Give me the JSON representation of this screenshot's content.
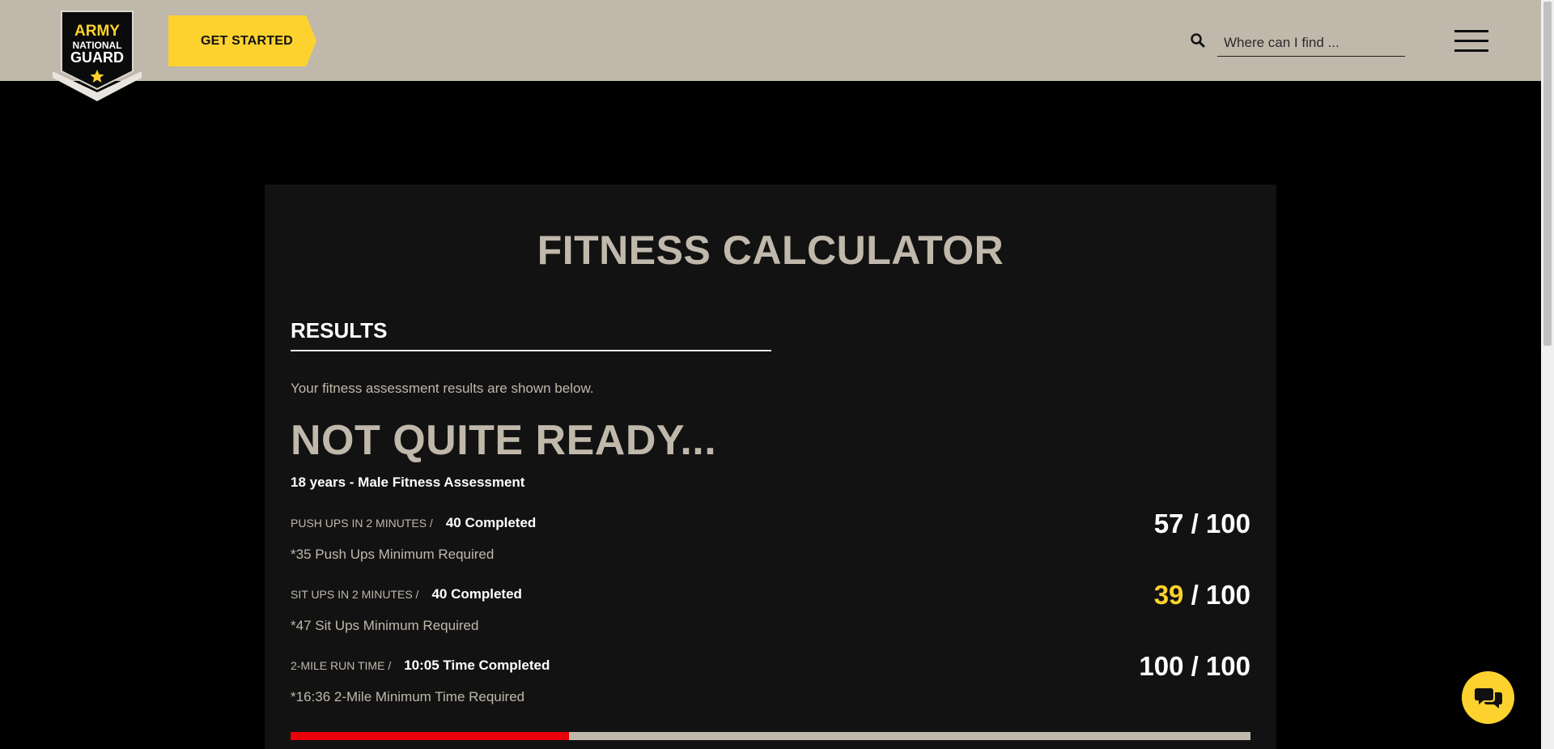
{
  "header": {
    "logo": {
      "line1": "ARMY",
      "line2": "NATIONAL",
      "line3": "GUARD",
      "icon": "star-icon"
    },
    "get_started_label": "GET STARTED",
    "search": {
      "placeholder": "Where can I find ...",
      "icon": "search-icon"
    },
    "menu_icon": "hamburger-menu-icon"
  },
  "calculator": {
    "title": "FITNESS CALCULATOR",
    "results_heading": "RESULTS",
    "intro": "Your fitness assessment results are shown below.",
    "verdict": "NOT QUITE READY...",
    "assessment": "18 years - Male Fitness Assessment",
    "rows": [
      {
        "label": "PUSH UPS IN 2 MINUTES /",
        "completed": "40 Completed",
        "note": "*35 Push Ups Minimum Required",
        "score": "57",
        "max": "/ 100"
      },
      {
        "label": "SIT UPS IN 2 MINUTES /",
        "completed": "40 Completed",
        "note": "*47 Sit Ups Minimum Required",
        "score": "39",
        "max": "/ 100"
      },
      {
        "label": "2-MILE RUN TIME /",
        "completed": "10:05 Time Completed",
        "note": "*16:36 2-Mile Minimum Time Required",
        "score": "100",
        "max": "/ 100"
      }
    ],
    "progress_fraction": 0.29
  },
  "colors": {
    "header_bg": "#c0b8ab",
    "accent_yellow": "#fdd22e",
    "progress_red": "#e8000b",
    "card_bg": "#121212"
  },
  "chat_icon": "chat-bubbles-icon"
}
